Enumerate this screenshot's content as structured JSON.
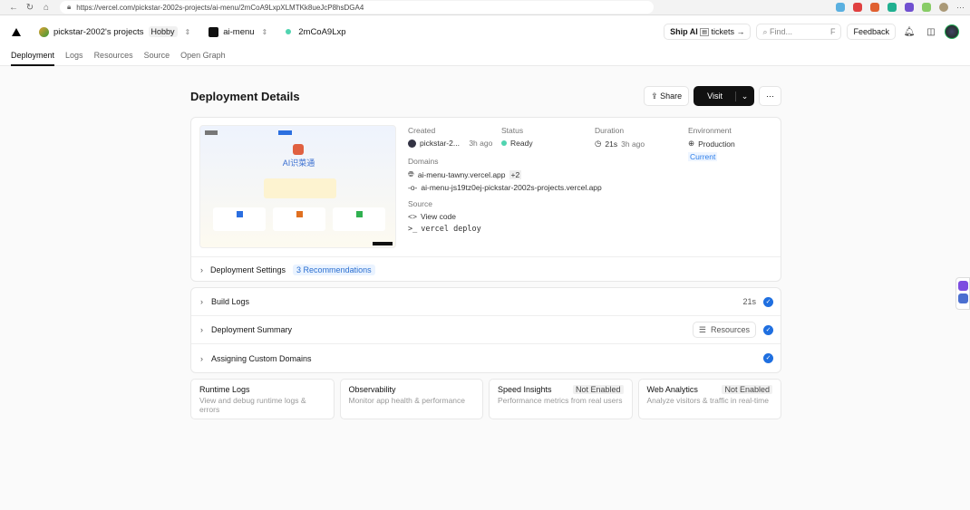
{
  "browser": {
    "url": "https://vercel.com/pickstar-2002s-projects/ai-menu/2mCoA9LxpXLMTKk8ueJcP8hsDGA4"
  },
  "header": {
    "team": "pickstar-2002's projects",
    "plan": "Hobby",
    "project": "ai-menu",
    "deployment": "2mCoA9Lxp",
    "ship_pre": "Ship AI",
    "ship_post": "tickets →",
    "find_placeholder": "Find...",
    "find_key": "F",
    "feedback": "Feedback"
  },
  "tabs": [
    "Deployment",
    "Logs",
    "Resources",
    "Source",
    "Open Graph"
  ],
  "page": {
    "title": "Deployment Details",
    "share": "Share",
    "visit": "Visit"
  },
  "details": {
    "created_label": "Created",
    "created_by": "pickstar-2...",
    "created_time": "3h ago",
    "status_label": "Status",
    "status": "Ready",
    "duration_label": "Duration",
    "duration": "21s",
    "duration_time": "3h ago",
    "env_label": "Environment",
    "env": "Production",
    "env_badge": "Current",
    "domains_label": "Domains",
    "domain1": "ai-menu-tawny.vercel.app",
    "domain_more": "+2",
    "domain2": "ai-menu-js19tz0ej-pickstar-2002s-projects.vercel.app",
    "source_label": "Source",
    "view_code": "View code",
    "cli": "vercel deploy",
    "thumb_title": "AI识菜通"
  },
  "settings": {
    "label": "Deployment Settings",
    "recommendations": "3 Recommendations"
  },
  "steps": [
    {
      "label": "Build Logs",
      "right": "21s"
    },
    {
      "label": "Deployment Summary",
      "right": "Resources"
    },
    {
      "label": "Assigning Custom Domains"
    }
  ],
  "tiles": [
    {
      "title": "Runtime Logs",
      "desc": "View and debug runtime logs & errors"
    },
    {
      "title": "Observability",
      "desc": "Monitor app health & performance"
    },
    {
      "title": "Speed Insights",
      "badge": "Not Enabled",
      "desc": "Performance metrics from real users"
    },
    {
      "title": "Web Analytics",
      "badge": "Not Enabled",
      "desc": "Analyze visitors & traffic in real-time"
    }
  ]
}
